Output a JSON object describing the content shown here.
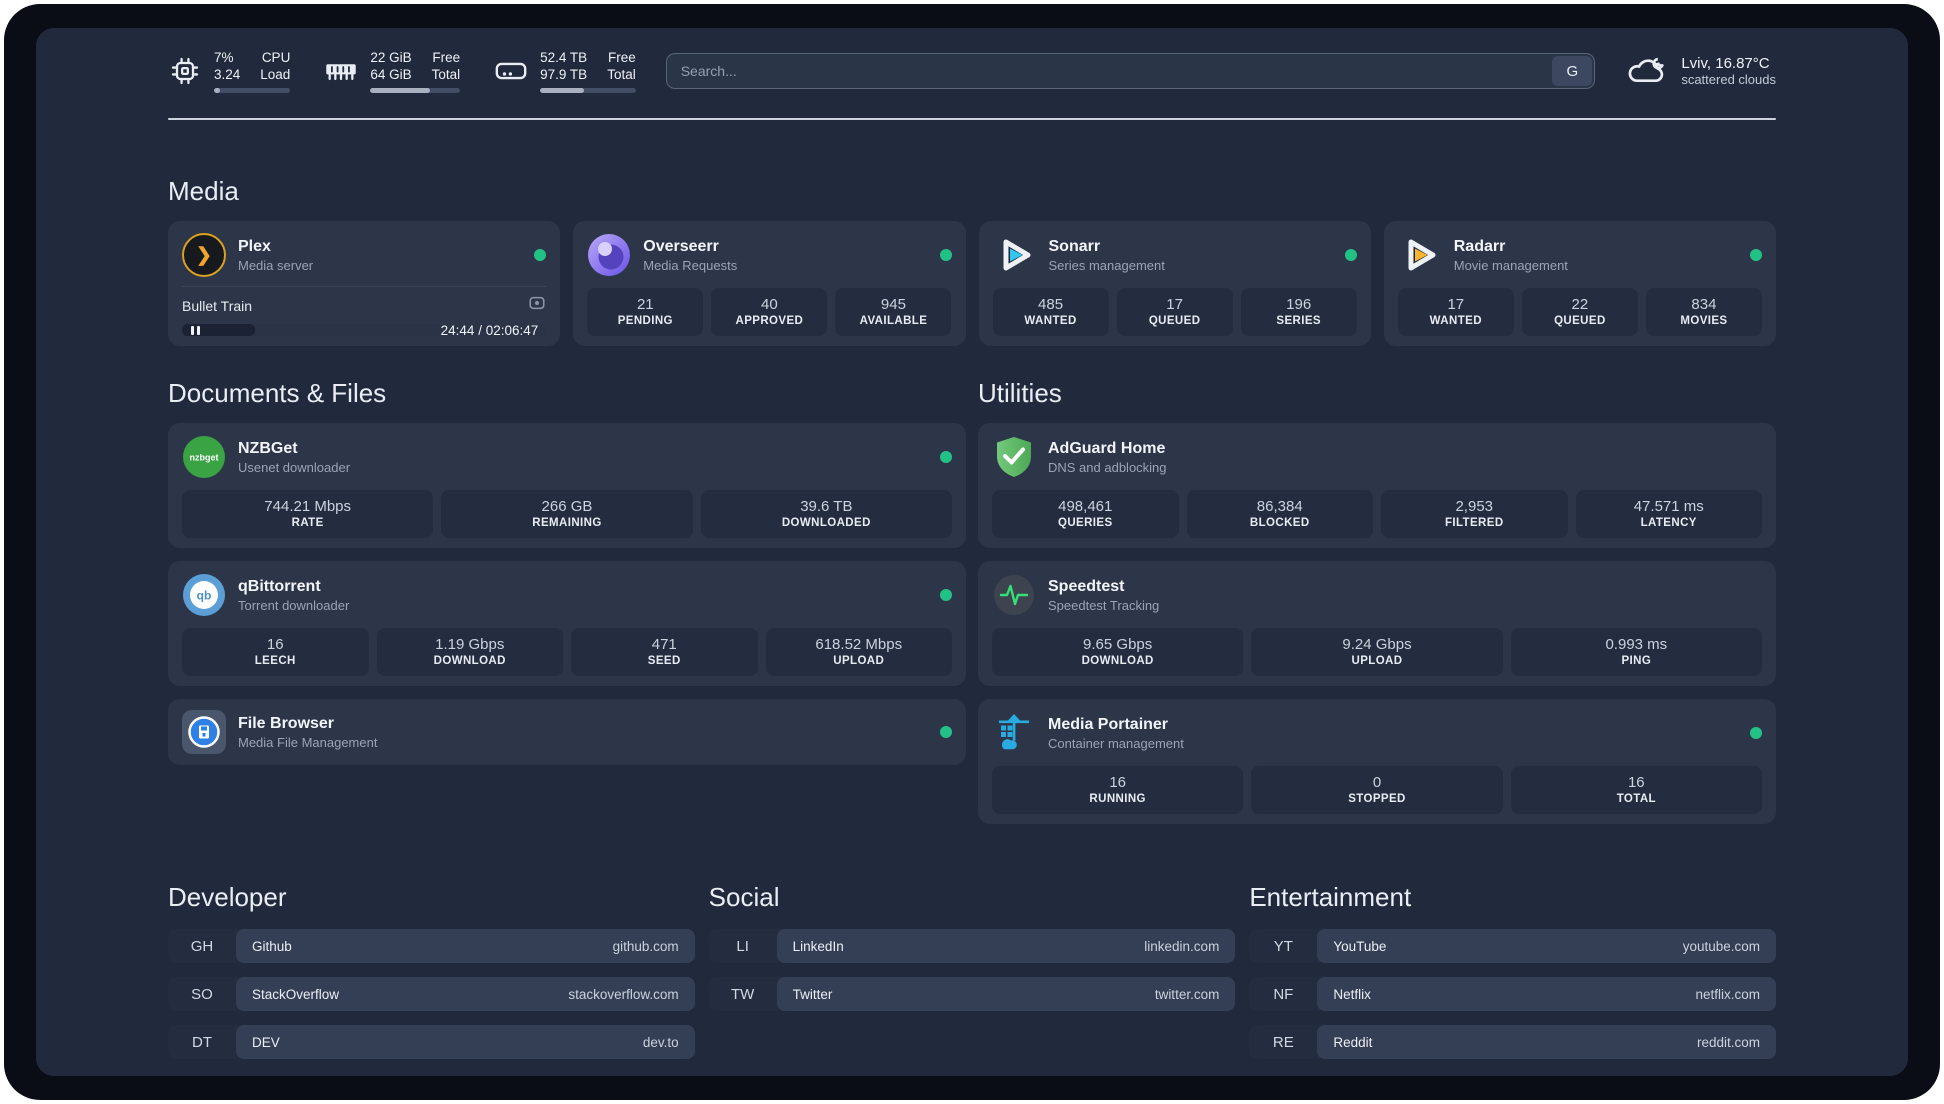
{
  "header": {
    "stats": [
      {
        "icon": "cpu-icon",
        "values": [
          "7%",
          "3.24"
        ],
        "labels": [
          "CPU",
          "Load"
        ],
        "progress": 8
      },
      {
        "icon": "ram-icon",
        "values": [
          "22 GiB",
          "64 GiB"
        ],
        "labels": [
          "Free",
          "Total"
        ],
        "progress": 66
      },
      {
        "icon": "disk-icon",
        "values": [
          "52.4 TB",
          "97.9 TB"
        ],
        "labels": [
          "Free",
          "Total"
        ],
        "progress": 46
      }
    ],
    "search": {
      "placeholder": "Search...",
      "engine": "G"
    },
    "weather": {
      "title": "Lviv, 16.87°C",
      "subtitle": "scattered clouds"
    }
  },
  "media": {
    "heading": "Media",
    "plex": {
      "name": "Plex",
      "subtitle": "Media server",
      "now_playing": "Bullet Train",
      "time": "24:44 / 02:06:47",
      "progress": 20
    },
    "overseerr": {
      "name": "Overseerr",
      "subtitle": "Media Requests",
      "stats": [
        {
          "value": "21",
          "label": "PENDING"
        },
        {
          "value": "40",
          "label": "APPROVED"
        },
        {
          "value": "945",
          "label": "AVAILABLE"
        }
      ]
    },
    "sonarr": {
      "name": "Sonarr",
      "subtitle": "Series management",
      "stats": [
        {
          "value": "485",
          "label": "WANTED"
        },
        {
          "value": "17",
          "label": "QUEUED"
        },
        {
          "value": "196",
          "label": "SERIES"
        }
      ]
    },
    "radarr": {
      "name": "Radarr",
      "subtitle": "Movie management",
      "stats": [
        {
          "value": "17",
          "label": "WANTED"
        },
        {
          "value": "22",
          "label": "QUEUED"
        },
        {
          "value": "834",
          "label": "MOVIES"
        }
      ]
    }
  },
  "documents": {
    "heading": "Documents & Files",
    "nzbget": {
      "name": "NZBGet",
      "subtitle": "Usenet downloader",
      "stats": [
        {
          "value": "744.21 Mbps",
          "label": "RATE"
        },
        {
          "value": "266 GB",
          "label": "REMAINING"
        },
        {
          "value": "39.6 TB",
          "label": "DOWNLOADED"
        }
      ]
    },
    "qbittorrent": {
      "name": "qBittorrent",
      "subtitle": "Torrent downloader",
      "stats": [
        {
          "value": "16",
          "label": "LEECH"
        },
        {
          "value": "1.19 Gbps",
          "label": "DOWNLOAD"
        },
        {
          "value": "471",
          "label": "SEED"
        },
        {
          "value": "618.52 Mbps",
          "label": "UPLOAD"
        }
      ]
    },
    "filebrowser": {
      "name": "File Browser",
      "subtitle": "Media File Management"
    }
  },
  "utilities": {
    "heading": "Utilities",
    "adguard": {
      "name": "AdGuard Home",
      "subtitle": "DNS and adblocking",
      "stats": [
        {
          "value": "498,461",
          "label": "QUERIES"
        },
        {
          "value": "86,384",
          "label": "BLOCKED"
        },
        {
          "value": "2,953",
          "label": "FILTERED"
        },
        {
          "value": "47.571 ms",
          "label": "LATENCY"
        }
      ]
    },
    "speedtest": {
      "name": "Speedtest",
      "subtitle": "Speedtest Tracking",
      "stats": [
        {
          "value": "9.65 Gbps",
          "label": "DOWNLOAD"
        },
        {
          "value": "9.24 Gbps",
          "label": "UPLOAD"
        },
        {
          "value": "0.993 ms",
          "label": "PING"
        }
      ]
    },
    "portainer": {
      "name": "Media Portainer",
      "subtitle": "Container management",
      "stats": [
        {
          "value": "16",
          "label": "RUNNING"
        },
        {
          "value": "0",
          "label": "STOPPED"
        },
        {
          "value": "16",
          "label": "TOTAL"
        }
      ]
    }
  },
  "bookmarks": [
    {
      "heading": "Developer",
      "links": [
        {
          "abbr": "GH",
          "name": "Github",
          "url": "github.com"
        },
        {
          "abbr": "SO",
          "name": "StackOverflow",
          "url": "stackoverflow.com"
        },
        {
          "abbr": "DT",
          "name": "DEV",
          "url": "dev.to"
        }
      ]
    },
    {
      "heading": "Social",
      "links": [
        {
          "abbr": "LI",
          "name": "LinkedIn",
          "url": "linkedin.com"
        },
        {
          "abbr": "TW",
          "name": "Twitter",
          "url": "twitter.com"
        }
      ]
    },
    {
      "heading": "Entertainment",
      "links": [
        {
          "abbr": "YT",
          "name": "YouTube",
          "url": "youtube.com"
        },
        {
          "abbr": "NF",
          "name": "Netflix",
          "url": "netflix.com"
        },
        {
          "abbr": "RE",
          "name": "Reddit",
          "url": "reddit.com"
        }
      ]
    }
  ],
  "icons": {
    "nzbget_text": "nzbget",
    "qb_text": "qb",
    "plex_chevron": "❯"
  },
  "colors": {
    "status_online": "#22c287",
    "panel": "#212a3d",
    "card": "#2c3648",
    "stat_box": "#232d3f"
  }
}
